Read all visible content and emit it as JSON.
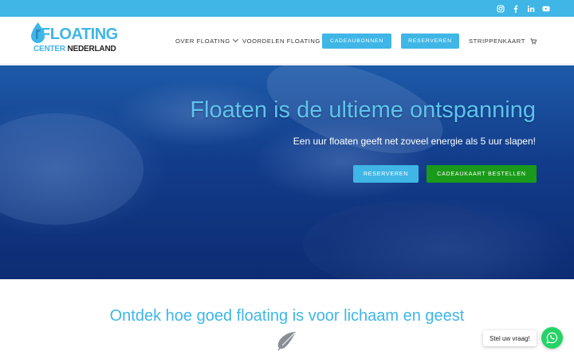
{
  "social": {
    "icons": [
      "instagram-icon",
      "facebook-icon",
      "linkedin-icon",
      "youtube-icon"
    ]
  },
  "logo": {
    "line1": "FLOATING",
    "line2_a": "CENTER",
    "line2_b": "NEDERLAND",
    "icon": "water-drop-icon"
  },
  "nav": {
    "items": [
      {
        "label": "OVER FLOATING",
        "has_dropdown": true
      },
      {
        "label": "VOORDELEN FLOATING"
      },
      {
        "label": "CADEAUBONNEN",
        "style": "button"
      },
      {
        "label": "RESERVEREN",
        "style": "button"
      },
      {
        "label": "STRIPPENKAART"
      }
    ],
    "cart_icon": "cart-icon"
  },
  "hero": {
    "title": "Floaten is de ultieme ontspanning",
    "subtitle": "Een uur floaten geeft net zoveel energie als 5 uur slapen!",
    "btn_reserve": "RESERVEREN",
    "btn_gift": "CADEAUKAART BESTELLEN"
  },
  "intro": {
    "title": "Ontdek hoe goed floating is voor lichaam en geest",
    "icon": "feather-icon"
  },
  "chat": {
    "label": "Stel uw vraag!",
    "icon": "whatsapp-icon"
  },
  "colors": {
    "accent": "#3fb6e6",
    "green": "#1a9a1a",
    "whatsapp": "#25d366"
  }
}
